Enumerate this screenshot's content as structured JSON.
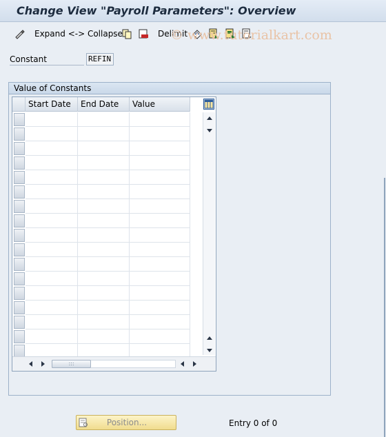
{
  "window": {
    "title": "Change View \"Payroll Parameters\": Overview"
  },
  "toolbar": {
    "expand_collapse_label": "Expand <-> Collapse",
    "delimit_label": "Delimit",
    "icons": [
      "change-display-icon",
      "copy-icon",
      "delete-icon",
      "undo-icon",
      "select-all-icon",
      "select-block-icon",
      "deselect-all-icon"
    ]
  },
  "watermark": {
    "text": "© www.tutorialkart.com"
  },
  "constant": {
    "label": "Constant",
    "value": "REFIN"
  },
  "group": {
    "title": "Value of Constants"
  },
  "table": {
    "columns": [
      "Start Date",
      "End Date",
      "Value"
    ],
    "rows": []
  },
  "footer": {
    "position_button_label": "Position...",
    "entry_text": "Entry 0 of 0"
  },
  "colors": {
    "background": "#e9eef4",
    "title_text": "#1d2c3f",
    "position_button": "#f0dc8e"
  }
}
